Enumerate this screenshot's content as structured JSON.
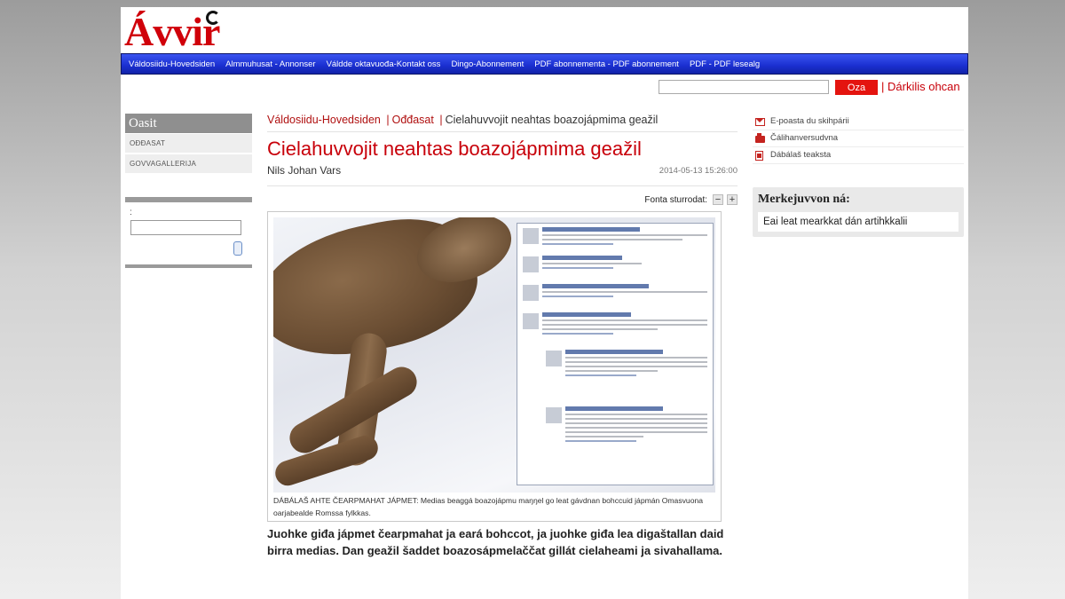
{
  "site": {
    "logo": "Ávvir",
    "brand_color": "#d0000a",
    "nav_color": "#1a2fd0"
  },
  "nav": {
    "items": [
      "Váldosiidu-Hovedsiden",
      "Almmuhusat - Annonser",
      "Váldde oktavuođa-Kontakt oss",
      "Dingo-Abonnement",
      "PDF abonnementa - PDF abonnement",
      "PDF - PDF lesealg"
    ]
  },
  "search": {
    "value": "",
    "button_label": "Oza",
    "separator": "|",
    "advanced_label": "Dárkilis ohcan"
  },
  "sidebar": {
    "heading": "Oasit",
    "items": [
      "Ođđasat",
      "Govvagallerija"
    ],
    "box_label": ":",
    "box_value": ""
  },
  "article": {
    "breadcrumb": [
      "Váldosiidu-Hovedsiden",
      "Ođđasat",
      "Cielahuvvojit neahtas boazojápmima geažil"
    ],
    "breadcrumb_sep": "|",
    "title": "Cielahuvvojit neahtas boazojápmima geažil",
    "author": "Nils Johan Vars",
    "date": "2014-05-13 15:26:00",
    "font_size_label": "Fonta sturrodat:",
    "font_decrease": "−",
    "font_increase": "+",
    "caption": "DÁBÁLAŠ AHTE ČEARPMAHAT JÁPMET: Medias beaggá boazojápmu maŋŋel go leat gávdnan bohccuid jápmán Omasvuona oarjabealde Romssa fylkkas.",
    "lead": "Juohke giđa jápmet čearpmahat ja eará bohccot, ja juohke giđa lea digaštallan daid birra medias. Dan geažil šaddet boazosápmelaččat gillát cielaheami ja sivahallama."
  },
  "tools": {
    "email_label": "E-poasta du skihpárii",
    "print_label": "Čálihanversudvna",
    "text_label": "Dábálaš teaksta"
  },
  "keywords": {
    "title": "Merkejuvvon ná:",
    "empty_text": "Eai leat mearkkat dán artihkkalii"
  }
}
